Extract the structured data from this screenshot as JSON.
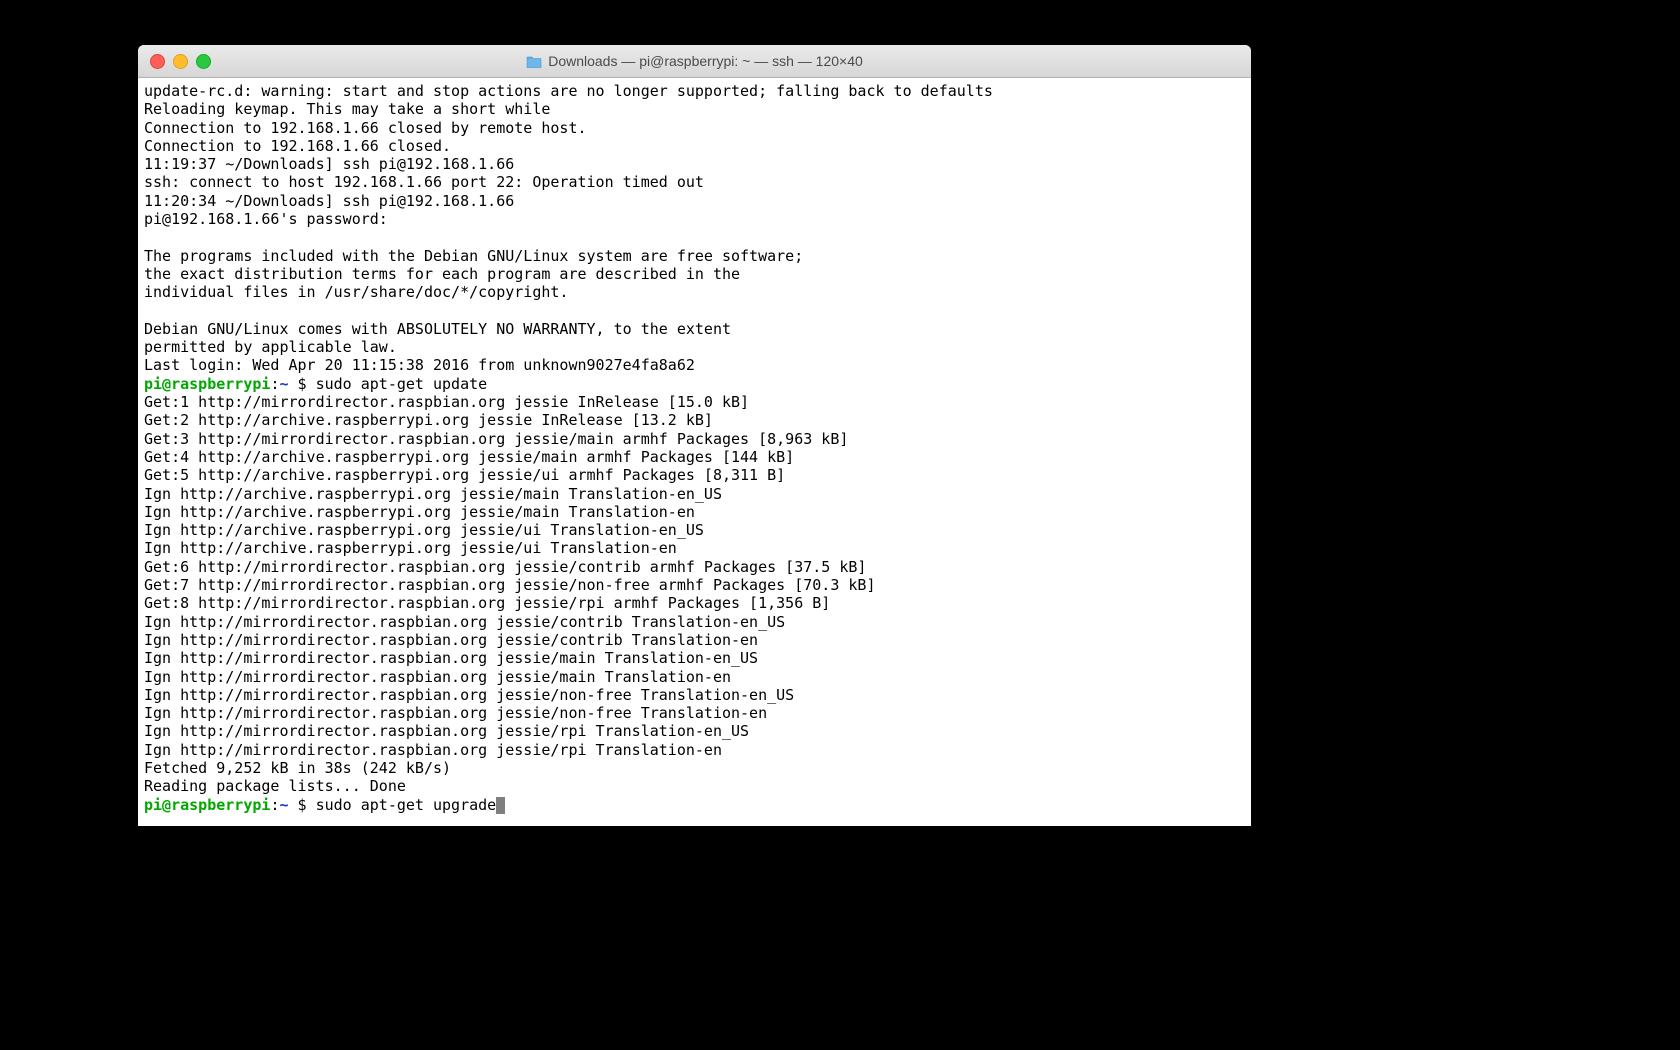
{
  "window": {
    "title": "Downloads — pi@raspberrypi: ~ — ssh — 120×40"
  },
  "prompt": {
    "user_host": "pi@raspberrypi",
    "sep": ":",
    "path": "~",
    "sigil": " $ "
  },
  "lines": {
    "l00": "update-rc.d: warning: start and stop actions are no longer supported; falling back to defaults",
    "l01": "Reloading keymap. This may take a short while",
    "l02": "Connection to 192.168.1.66 closed by remote host.",
    "l03": "Connection to 192.168.1.66 closed.",
    "l04": "11:19:37 ~/Downloads] ssh pi@192.168.1.66",
    "l05": "ssh: connect to host 192.168.1.66 port 22: Operation timed out",
    "l06": "11:20:34 ~/Downloads] ssh pi@192.168.1.66",
    "l07": "pi@192.168.1.66's password:",
    "l08": "",
    "l09": "The programs included with the Debian GNU/Linux system are free software;",
    "l10": "the exact distribution terms for each program are described in the",
    "l11": "individual files in /usr/share/doc/*/copyright.",
    "l12": "",
    "l13": "Debian GNU/Linux comes with ABSOLUTELY NO WARRANTY, to the extent",
    "l14": "permitted by applicable law.",
    "l15": "Last login: Wed Apr 20 11:15:38 2016 from unknown9027e4fa8a62",
    "cmd1": "sudo apt-get update",
    "l17": "Get:1 http://mirrordirector.raspbian.org jessie InRelease [15.0 kB]",
    "l18": "Get:2 http://archive.raspberrypi.org jessie InRelease [13.2 kB]",
    "l19": "Get:3 http://mirrordirector.raspbian.org jessie/main armhf Packages [8,963 kB]",
    "l20": "Get:4 http://archive.raspberrypi.org jessie/main armhf Packages [144 kB]",
    "l21": "Get:5 http://archive.raspberrypi.org jessie/ui armhf Packages [8,311 B]",
    "l22": "Ign http://archive.raspberrypi.org jessie/main Translation-en_US",
    "l23": "Ign http://archive.raspberrypi.org jessie/main Translation-en",
    "l24": "Ign http://archive.raspberrypi.org jessie/ui Translation-en_US",
    "l25": "Ign http://archive.raspberrypi.org jessie/ui Translation-en",
    "l26": "Get:6 http://mirrordirector.raspbian.org jessie/contrib armhf Packages [37.5 kB]",
    "l27": "Get:7 http://mirrordirector.raspbian.org jessie/non-free armhf Packages [70.3 kB]",
    "l28": "Get:8 http://mirrordirector.raspbian.org jessie/rpi armhf Packages [1,356 B]",
    "l29": "Ign http://mirrordirector.raspbian.org jessie/contrib Translation-en_US",
    "l30": "Ign http://mirrordirector.raspbian.org jessie/contrib Translation-en",
    "l31": "Ign http://mirrordirector.raspbian.org jessie/main Translation-en_US",
    "l32": "Ign http://mirrordirector.raspbian.org jessie/main Translation-en",
    "l33": "Ign http://mirrordirector.raspbian.org jessie/non-free Translation-en_US",
    "l34": "Ign http://mirrordirector.raspbian.org jessie/non-free Translation-en",
    "l35": "Ign http://mirrordirector.raspbian.org jessie/rpi Translation-en_US",
    "l36": "Ign http://mirrordirector.raspbian.org jessie/rpi Translation-en",
    "l37": "Fetched 9,252 kB in 38s (242 kB/s)",
    "l38": "Reading package lists... Done",
    "cmd2": "sudo apt-get upgrade"
  }
}
